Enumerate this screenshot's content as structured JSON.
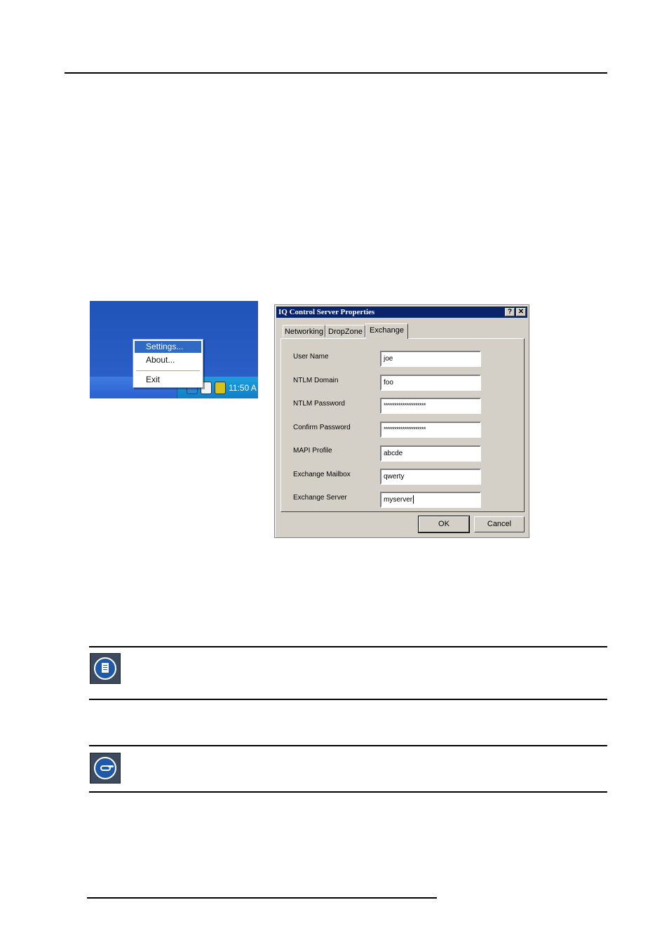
{
  "tray_menu": {
    "items": [
      {
        "label": "Settings..."
      },
      {
        "label": "About..."
      },
      {
        "label": "Exit"
      }
    ],
    "clock": "11:50 A"
  },
  "dialog": {
    "title": "IQ Control Server Properties",
    "help_label": "?",
    "close_label": "✕",
    "tabs": [
      {
        "label": "Networking"
      },
      {
        "label": "DropZone"
      },
      {
        "label": "Exchange",
        "active": true
      }
    ],
    "fields": [
      {
        "label": "User Name",
        "value": "joe"
      },
      {
        "label": "NTLM Domain",
        "value": "foo"
      },
      {
        "label": "NTLM Password",
        "value": "********************"
      },
      {
        "label": "Confirm Password",
        "value": "********************"
      },
      {
        "label": "MAPI Profile",
        "value": "abcde"
      },
      {
        "label": "Exchange Mailbox",
        "value": "qwerty"
      },
      {
        "label": "Exchange Server",
        "value": "myserver"
      }
    ],
    "ok_label": "OK",
    "cancel_label": "Cancel"
  },
  "icons": {
    "note": "note-icon",
    "tip": "tip-icon"
  },
  "colors": {
    "title_bar": "#0a246a",
    "menu_highlight": "#316ac5",
    "dialog_face": "#d4d0c8",
    "icon_blue": "#1f5aa8"
  }
}
